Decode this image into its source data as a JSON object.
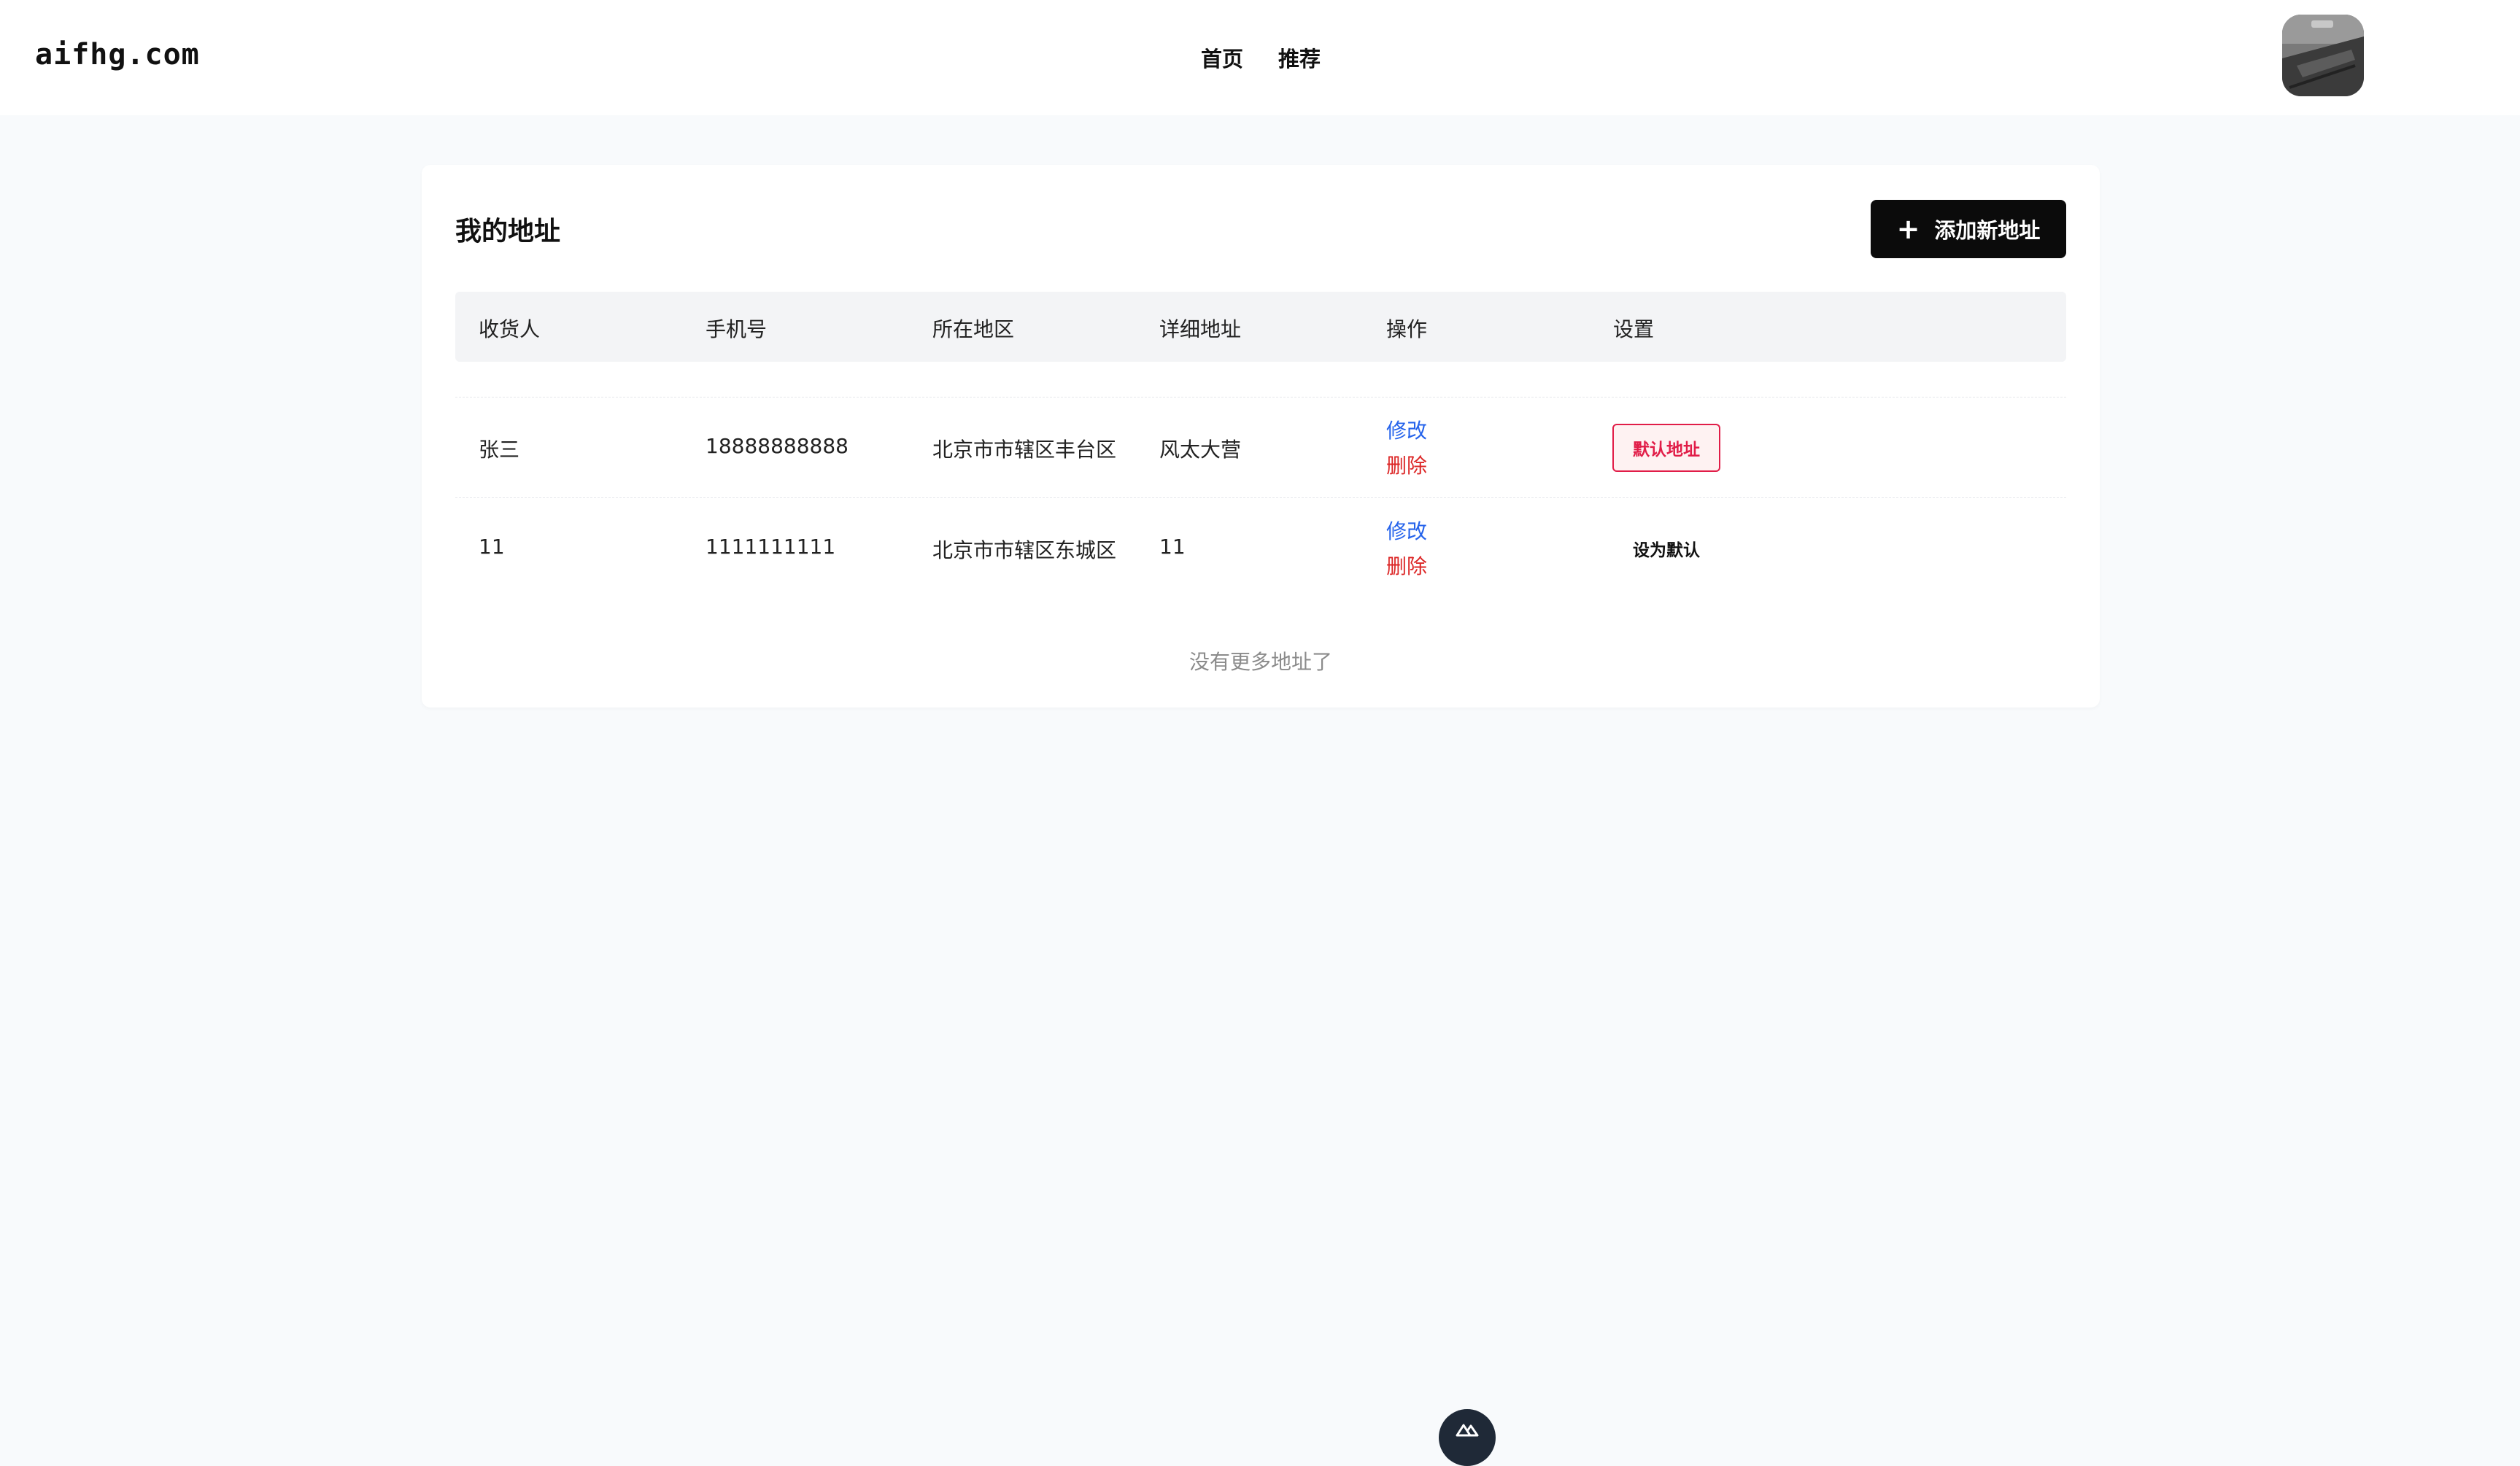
{
  "header": {
    "logo": "aifhg.com",
    "nav": [
      "首页",
      "推荐"
    ]
  },
  "address_page": {
    "title": "我的地址",
    "add_button_label": "添加新地址",
    "columns": [
      "收货人",
      "手机号",
      "所在地区",
      "详细地址",
      "操作",
      "设置"
    ],
    "rows": [
      {
        "receiver": "张三",
        "phone": "18888888888",
        "region": "北京市市辖区丰台区",
        "detail": "风太大营",
        "edit_label": "修改",
        "delete_label": "删除",
        "setting_label": "默认地址",
        "is_default": true
      },
      {
        "receiver": "11",
        "phone": "1111111111",
        "region": "北京市市辖区东城区",
        "detail": "11",
        "edit_label": "修改",
        "delete_label": "删除",
        "setting_label": "设为默认",
        "is_default": false
      }
    ],
    "empty_hint": "没有更多地址了"
  },
  "icons": [
    "plus-icon",
    "avatar-image",
    "nuxt-devtools-icon"
  ],
  "colors": {
    "background": "#f8fafc",
    "primary_button": "#0b0b0b",
    "edit_link": "#2563eb",
    "delete_link": "#dc2626",
    "default_badge": "#e11d48"
  }
}
